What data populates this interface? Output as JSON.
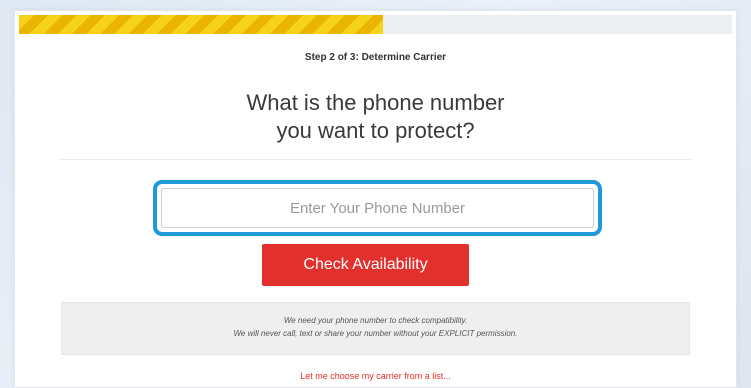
{
  "progress": {
    "fraction": 0.51
  },
  "step": {
    "label": "Step 2 of 3: Determine Carrier"
  },
  "question": {
    "line1": "What is the phone number",
    "line2": "you want to protect?"
  },
  "phone": {
    "placeholder": "Enter Your Phone Number",
    "value": ""
  },
  "check_button": {
    "label": "Check Availability"
  },
  "notice": {
    "line1": "We need your phone number to check compatibility.",
    "line2": "We will never call, text or share your number without your EXPLICIT permission."
  },
  "carrier_link": {
    "label": "Let me choose my carrier from a list..."
  },
  "colors": {
    "accent_red": "#e2312d",
    "highlight_blue": "#1e9ad6",
    "progress_yellow": "#f3c300"
  }
}
